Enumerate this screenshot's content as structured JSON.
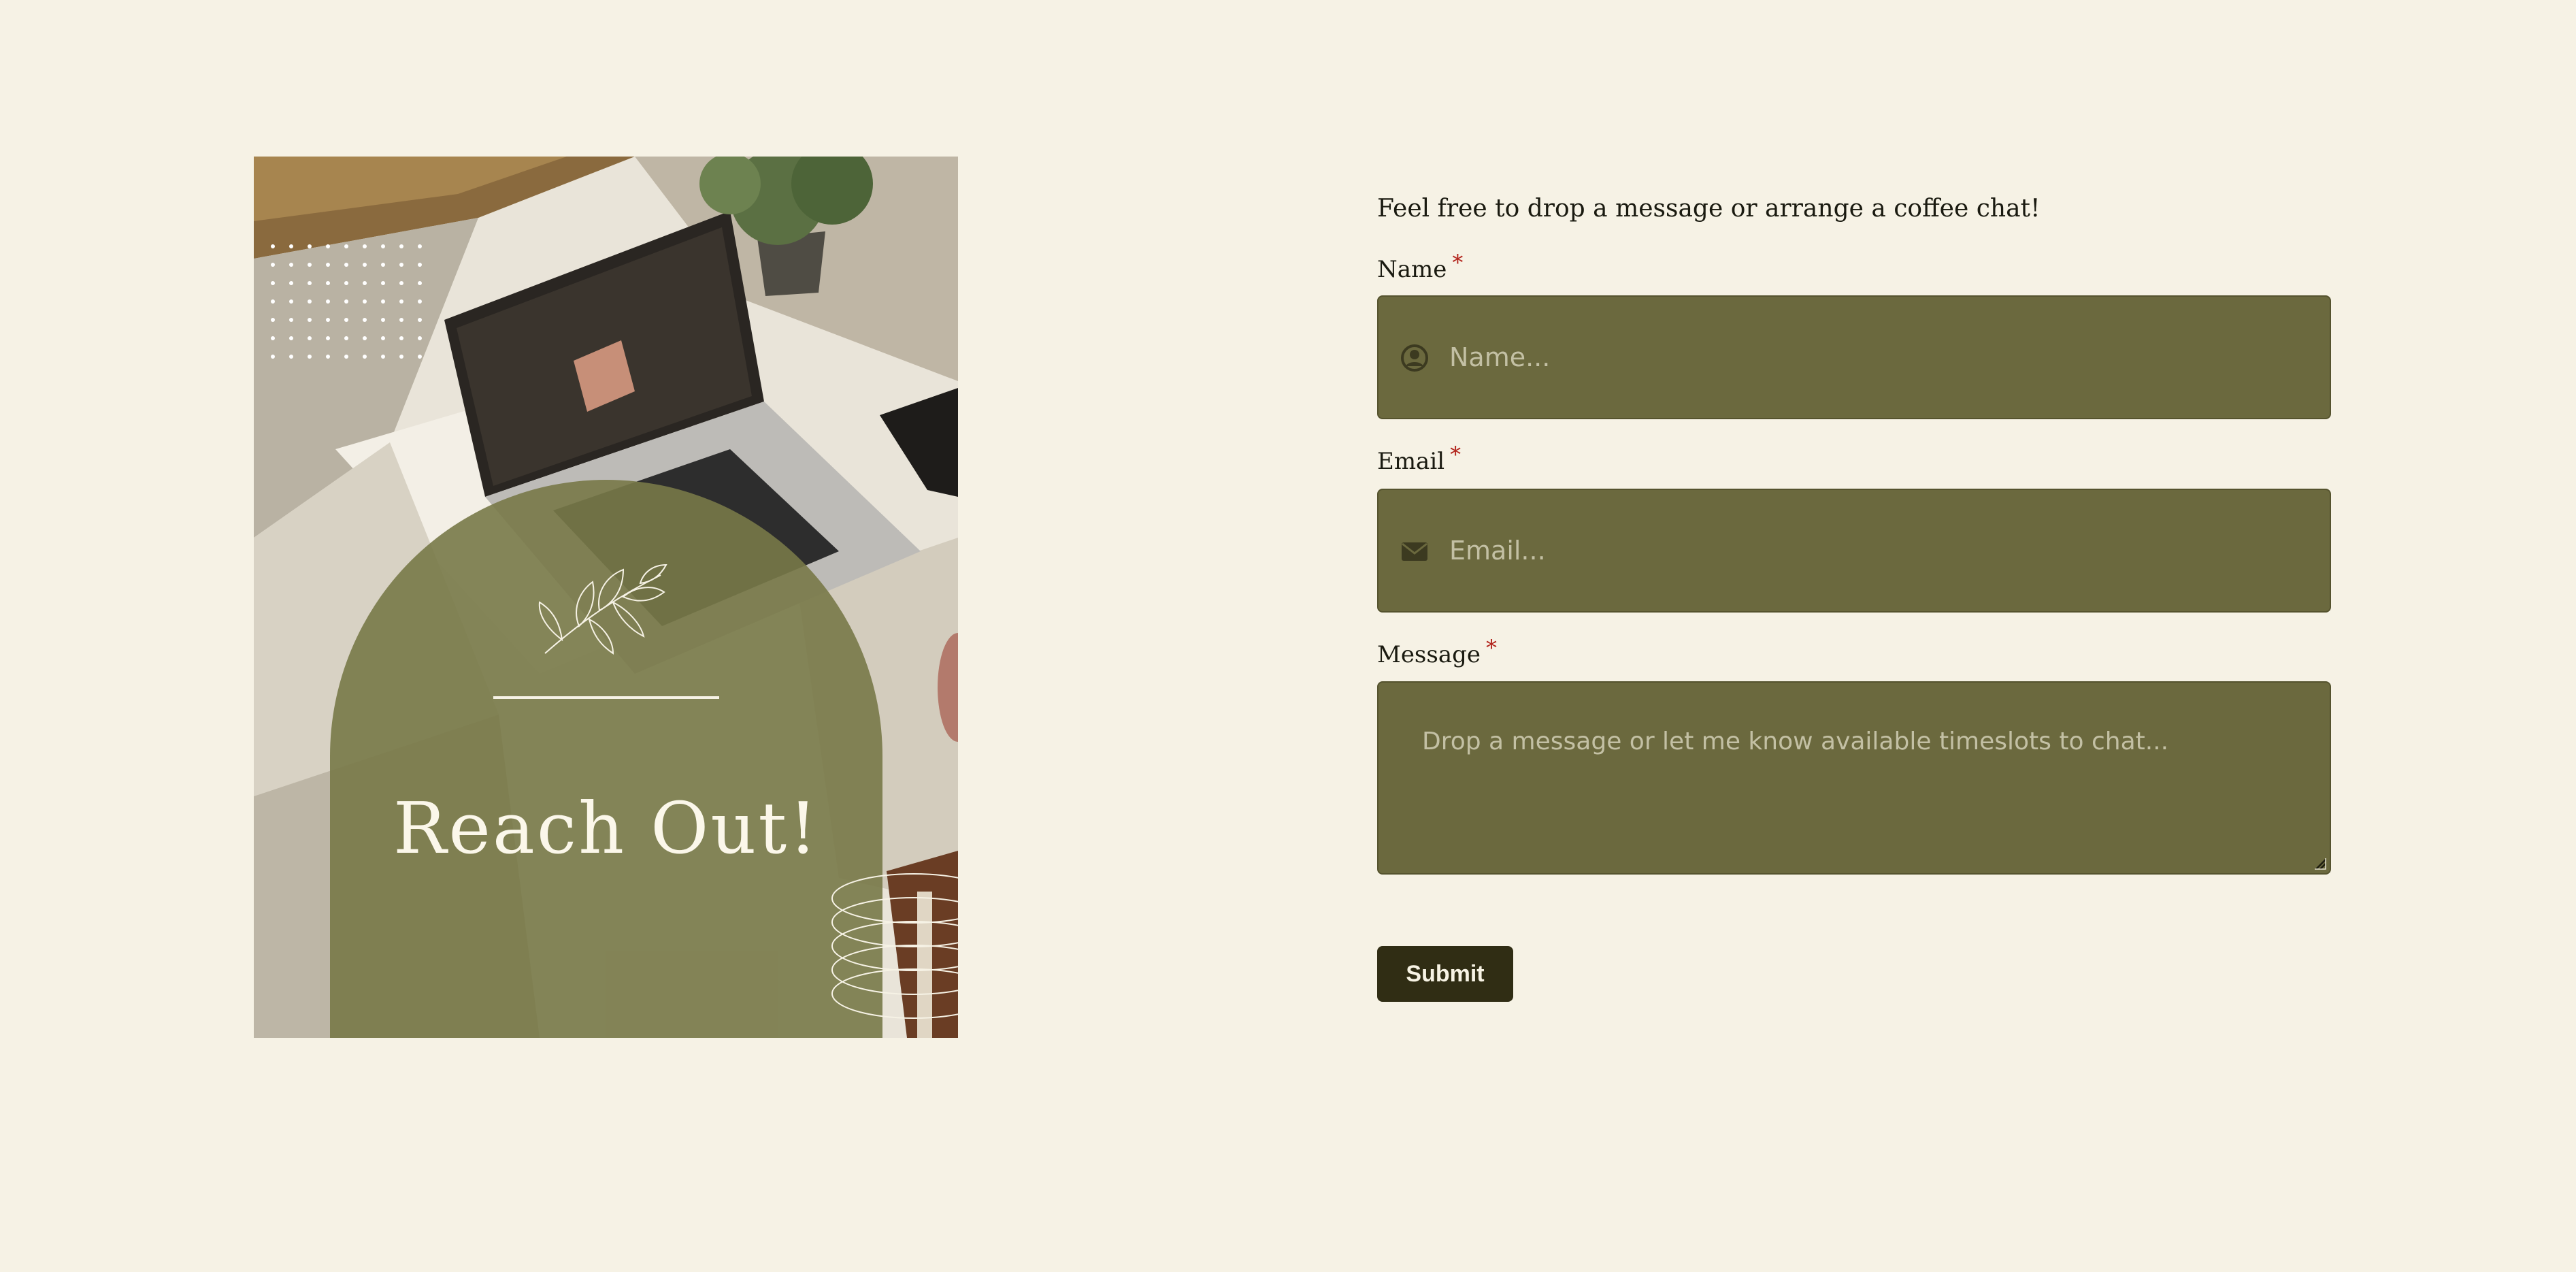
{
  "hero": {
    "title": "Reach Out!"
  },
  "form": {
    "intro": "Feel free to drop a message or arrange a coffee chat!",
    "required_mark": "*",
    "name": {
      "label": "Name",
      "placeholder": "Name...",
      "icon": "user-circle-icon"
    },
    "email": {
      "label": "Email",
      "placeholder": "Email...",
      "icon": "envelope-icon"
    },
    "message": {
      "label": "Message",
      "placeholder": "Drop a message or let me know available timeslots to chat..."
    },
    "submit_label": "Submit"
  },
  "colors": {
    "background": "#f6f2e5",
    "field_fill": "#6b693e",
    "arch_fill": "#787948",
    "button_fill": "#302d14",
    "required": "#b3261e"
  }
}
